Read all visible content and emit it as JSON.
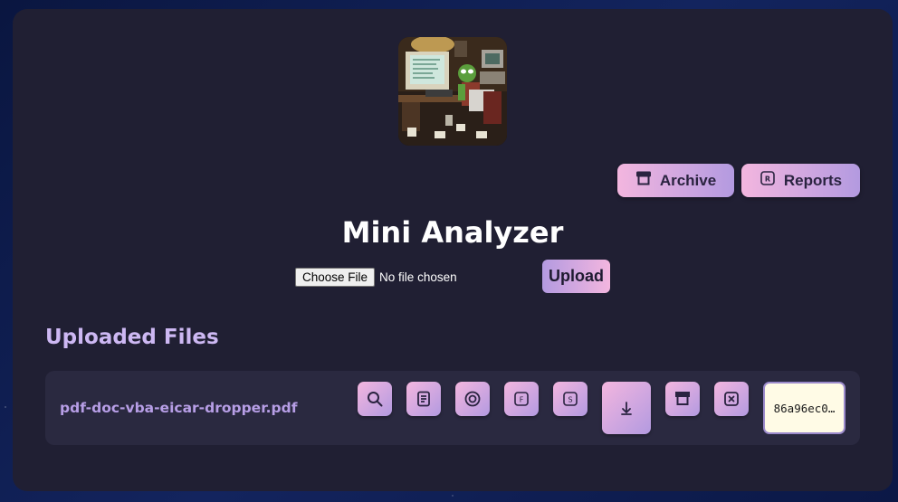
{
  "header": {
    "logo_alt": "pixel art of a frog at a retro computer desk",
    "archive_label": "Archive",
    "reports_label": "Reports"
  },
  "main": {
    "title": "Mini Analyzer",
    "file_input": {
      "button_label": "Choose File",
      "status_text": "No file chosen"
    },
    "upload_label": "Upload"
  },
  "files_section": {
    "title": "Uploaded Files",
    "files": [
      {
        "name": "pdf-doc-vba-eicar-dropper.pdf",
        "hash_display": "86a96ec0…",
        "actions": [
          {
            "name": "search-icon",
            "letter": ""
          },
          {
            "name": "document-icon",
            "letter": ""
          },
          {
            "name": "target-icon",
            "letter": ""
          },
          {
            "name": "letter-f-icon",
            "letter": "F"
          },
          {
            "name": "letter-s-icon",
            "letter": "S"
          },
          {
            "name": "download-icon",
            "letter": ""
          },
          {
            "name": "archive-icon",
            "letter": ""
          },
          {
            "name": "delete-icon",
            "letter": ""
          }
        ]
      }
    ]
  },
  "colors": {
    "panel": "#201f33",
    "button_gradient_start": "#f3b6df",
    "button_gradient_end": "#b39ae0",
    "section_title": "#cdb8f3",
    "file_name": "#b79ee6",
    "hash_bg": "#fffbe6"
  }
}
